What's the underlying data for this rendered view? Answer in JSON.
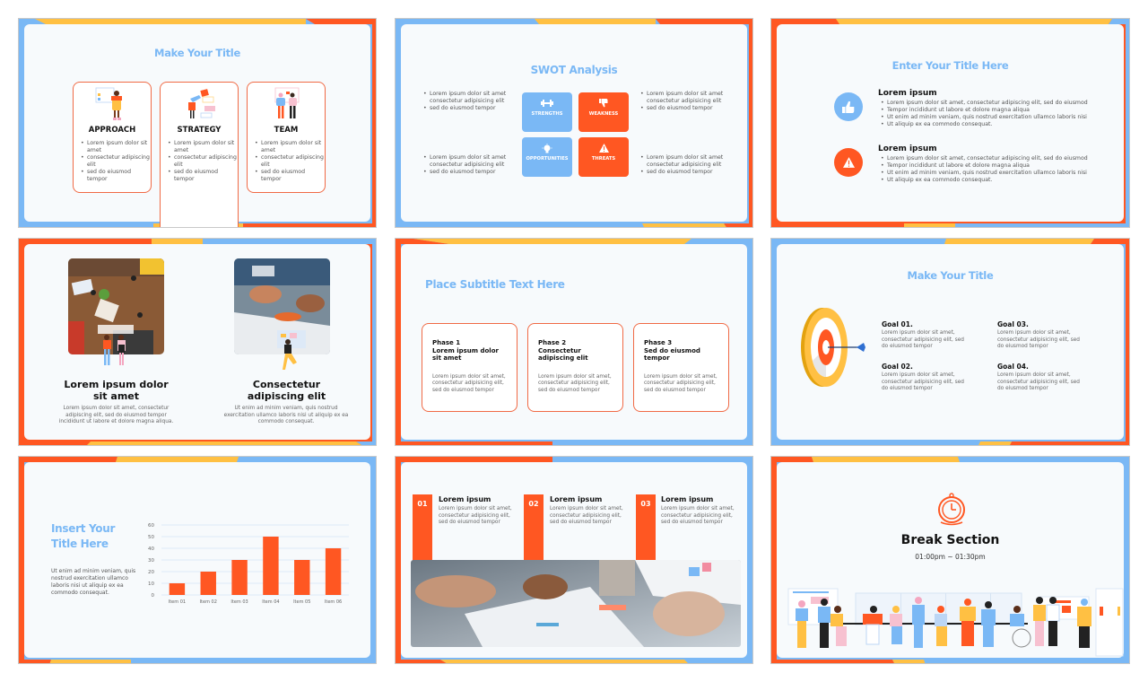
{
  "colors": {
    "blue": "#7ab8f5",
    "yellow": "#ffc043",
    "orange": "#ff5722",
    "card_bg": "#f7fafc",
    "text_dark": "#111111"
  },
  "slides": [
    {
      "title": "Make Your Title",
      "cards": [
        {
          "heading": "APPROACH",
          "bullets": [
            "Lorem ipsum dolor sit amet",
            "consectetur adipiscing elit",
            "sed do eiusmod tempor"
          ]
        },
        {
          "heading": "STRATEGY",
          "bullets": [
            "Lorem ipsum dolor sit amet",
            "consectetur adipiscing elit",
            "sed do eiusmod tempor"
          ]
        },
        {
          "heading": "TEAM",
          "bullets": [
            "Lorem ipsum dolor sit amet",
            "consectetur adipiscing elit",
            "sed do eiusmod tempor"
          ]
        }
      ]
    },
    {
      "title": "SWOT Analysis",
      "tiles": [
        {
          "label": "STRENGTHS",
          "icon": "dumbbell-icon"
        },
        {
          "label": "WEAKNESS",
          "icon": "thumbs-down-icon"
        },
        {
          "label": "OPPORTUNITIES",
          "icon": "lightbulb-icon"
        },
        {
          "label": "THREATS",
          "icon": "warning-icon"
        }
      ],
      "notes": [
        [
          "Lorem ipsum dolor sit amet consectetur adipisicing elit",
          "sed do eiusmod tempor"
        ],
        [
          "Lorem ipsum dolor sit amet consectetur adipisicing elit",
          "sed do eiusmod tempor"
        ],
        [
          "Lorem ipsum dolor sit amet consectetur adipisicing elit",
          "sed do eiusmod tempor"
        ],
        [
          "Lorem ipsum dolor sit amet consectetur adipisicing elit",
          "sed do eiusmod tempor"
        ]
      ]
    },
    {
      "title": "Enter Your Title Here",
      "items": [
        {
          "icon": "thumbs-up-icon",
          "heading": "Lorem ipsum",
          "bullets": [
            "Lorem ipsum dolor sit amet, consectetur adipiscing elit, sed do eiusmod",
            "Tempor incididunt ut labore et dolore magna aliqua",
            "Ut enim ad minim veniam, quis nostrud exercitation ullamco laboris nisi",
            "Ut aliquip ex ea commodo consequat."
          ]
        },
        {
          "icon": "warning-icon",
          "heading": "Lorem ipsum",
          "bullets": [
            "Lorem ipsum dolor sit amet, consectetur adipiscing elit, sed do eiusmod",
            "Tempor incididunt ut labore et dolore magna aliqua",
            "Ut enim ad minim veniam, quis nostrud exercitation ullamco laboris nisi",
            "Ut aliquip ex ea commodo consequat."
          ]
        }
      ]
    },
    {
      "columns": [
        {
          "heading": "Lorem ipsum dolor sit amet",
          "body": "Lorem ipsum dolor sit amet, consectetur adipiscing elit, sed do eiusmod tempor incididunt ut labore et dolore magna aliqua."
        },
        {
          "heading": "Consectetur adipiscing elit",
          "body": "Ut enim ad minim veniam, quis nostrud exercitation ullamco laboris nisi ut aliquip ex ea commodo consequat."
        }
      ]
    },
    {
      "title": "Place Subtitle Text Here",
      "phases": [
        {
          "phase": "Phase 1",
          "heading": "Lorem ipsum dolor sit amet",
          "body": "Lorem ipsum dolor sit amet, consectetur adipisicing elit, sed do eiusmod tempor"
        },
        {
          "phase": "Phase 2",
          "heading": "Consectetur adipiscing elit",
          "body": "Lorem ipsum dolor sit amet, consectetur adipisicing elit, sed do eiusmod tempor"
        },
        {
          "phase": "Phase 3",
          "heading": "Sed do eiusmod tempor",
          "body": "Lorem ipsum dolor sit amet, consectetur adipisicing elit, sed do eiusmod tempor"
        }
      ]
    },
    {
      "title": "Make Your Title",
      "goals": [
        {
          "heading": "Goal 01.",
          "body": "Lorem ipsum dolor sit amet, consectetur adipisicing elit, sed do eiusmod tempor"
        },
        {
          "heading": "Goal 02.",
          "body": "Lorem ipsum dolor sit amet, consectetur adipisicing elit, sed do eiusmod tempor"
        },
        {
          "heading": "Goal 03.",
          "body": "Lorem ipsum dolor sit amet, consectetur adipisicing elit, sed do eiusmod tempor"
        },
        {
          "heading": "Goal 04.",
          "body": "Lorem ipsum dolor sit amet, consectetur adipisicing elit, sed do eiusmod tempor"
        }
      ]
    },
    {
      "title_line1": "Insert Your",
      "title_line2": "Title Here",
      "body": "Ut enim ad minim veniam, quis nostrud exercitation ullamco laboris nisi ut aliquip ex ea commodo consequat."
    },
    {
      "columns": [
        {
          "number": "01",
          "heading": "Lorem ipsum",
          "body": "Lorem ipsum dolor sit amet, consectetur adipisicing elit, sed do eiusmod tempor"
        },
        {
          "number": "02",
          "heading": "Lorem ipsum",
          "body": "Lorem ipsum dolor sit amet, consectetur adipisicing elit, sed do eiusmod tempor"
        },
        {
          "number": "03",
          "heading": "Lorem ipsum",
          "body": "Lorem ipsum dolor sit amet, consectetur adipisicing elit, sed do eiusmod tempor"
        }
      ]
    },
    {
      "title": "Break Section",
      "time": "01:00pm ~ 01:30pm",
      "icon": "stopwatch-icon"
    }
  ],
  "chart_data": {
    "type": "bar",
    "categories": [
      "Item 01",
      "Item 02",
      "Item 03",
      "Item 04",
      "Item 05",
      "Item 06"
    ],
    "values": [
      10,
      20,
      30,
      50,
      30,
      40
    ],
    "yticks": [
      "0",
      "10",
      "20",
      "30",
      "40",
      "50",
      "60"
    ],
    "ylim": [
      0,
      60
    ],
    "grid": true,
    "bar_color": "#ff5722",
    "title": "",
    "xlabel": "",
    "ylabel": ""
  }
}
